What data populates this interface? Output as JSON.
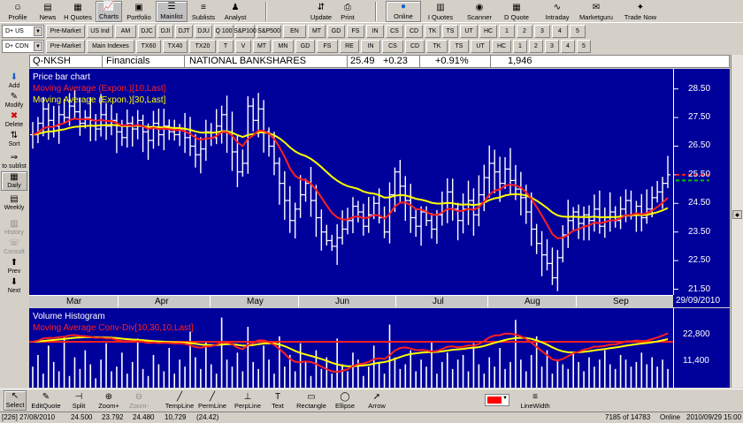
{
  "toolbar": {
    "items": [
      {
        "label": "Profile",
        "icon": "profile-icon",
        "glyph": "☺"
      },
      {
        "label": "News",
        "icon": "news-icon",
        "glyph": "▤"
      },
      {
        "label": "H Quotes",
        "icon": "history-quotes-icon",
        "glyph": "▦"
      },
      {
        "label": "Charts",
        "icon": "chart-icon",
        "glyph": "📈"
      },
      {
        "label": "Portfolio",
        "icon": "portfolio-icon",
        "glyph": "▣"
      },
      {
        "label": "Mainlist",
        "icon": "mainlist-icon",
        "glyph": "☰"
      },
      {
        "label": "Sublists",
        "icon": "sublists-icon",
        "glyph": "≡"
      },
      {
        "label": "Analyst",
        "icon": "analyst-icon",
        "glyph": "♟"
      },
      {
        "label": "Update",
        "icon": "update-icon",
        "glyph": "⇵"
      },
      {
        "label": "Print",
        "icon": "print-icon",
        "glyph": "⎙"
      },
      {
        "label": "Online",
        "icon": "online-globe-icon",
        "glyph": "●"
      },
      {
        "label": "I Quotes",
        "icon": "intraday-quotes-icon",
        "glyph": "▥"
      },
      {
        "label": "Scanner",
        "icon": "scanner-icon",
        "glyph": "◉"
      },
      {
        "label": "D Quote",
        "icon": "depth-quote-icon",
        "glyph": "▦"
      },
      {
        "label": "Intraday",
        "icon": "intraday-icon",
        "glyph": "∿"
      },
      {
        "label": "Marketguru",
        "icon": "marketguru-icon",
        "glyph": "✉"
      },
      {
        "label": "Trade Now",
        "icon": "trade-now-icon",
        "glyph": "✦"
      }
    ]
  },
  "row1": {
    "selector": "D+ US",
    "buttons": [
      "Pre-Market",
      "US Ind",
      "AM",
      "DJC",
      "DJI",
      "DJT",
      "DJU",
      "Q 100",
      "S&P100",
      "S&P500",
      "EN",
      "MT",
      "GD",
      "FS",
      "IN",
      "CS",
      "CD",
      "TK",
      "TS",
      "UT",
      "HC",
      "1",
      "2",
      "3",
      "4",
      "5"
    ]
  },
  "row2": {
    "selector": "D+ CDN",
    "buttons": [
      "Pre-Market",
      "Main Indexes",
      "TX60",
      "TX40",
      "TX20",
      "T",
      "V",
      "MT",
      "MN",
      "GD",
      "FS",
      "RE",
      "IN",
      "CS",
      "CD",
      "TK",
      "TS",
      "UT",
      "HC",
      "1",
      "2",
      "3",
      "4",
      "5"
    ]
  },
  "info": {
    "symbol": "Q-NKSH",
    "sector": "Financials",
    "name": "NATIONAL BANKSHARES",
    "price": "25.49",
    "change": "+0.23",
    "pct": "+0.91%",
    "volume": "1,946"
  },
  "sidebar": [
    {
      "label": "Add",
      "icon": "add-arrow-icon",
      "glyph": "⬇"
    },
    {
      "label": "Modify",
      "icon": "modify-pencil-icon",
      "glyph": "✎"
    },
    {
      "label": "Delete",
      "icon": "delete-x-icon",
      "glyph": "✖"
    },
    {
      "label": "Sort",
      "icon": "sort-icon",
      "glyph": "⇅"
    },
    {
      "label": "to sublist",
      "icon": "to-sublist-icon",
      "glyph": "⇒"
    },
    {
      "label": "Daily",
      "icon": "daily-icon",
      "glyph": "▦"
    },
    {
      "label": "Weekly",
      "icon": "weekly-icon",
      "glyph": "▤"
    },
    {
      "label": "History",
      "icon": "history-icon",
      "glyph": "▥"
    },
    {
      "label": "Consult",
      "icon": "consult-icon",
      "glyph": "☏"
    },
    {
      "label": "Prev",
      "icon": "prev-arrow-icon",
      "glyph": "⬆"
    },
    {
      "label": "Next",
      "icon": "next-arrow-icon",
      "glyph": "⬇"
    }
  ],
  "chart_data": [
    {
      "type": "bar",
      "title": "Price bar chart",
      "legend": [
        {
          "name": "Moving Average (Expon.)[10,Last]",
          "color": "#ff2020"
        },
        {
          "name": "Moving Average (Expon.)[30,Last]",
          "color": "#ffff00"
        }
      ],
      "x_labels": [
        "Mar",
        "Apr",
        "May",
        "Jun",
        "Jul",
        "Aug",
        "Sep"
      ],
      "y_ticks": [
        "28.50",
        "27.50",
        "26.50",
        "25.50",
        "24.50",
        "23.50",
        "22.50",
        "21.50"
      ],
      "ylim": [
        21.3,
        29.2
      ],
      "last_date": "29/09/2010",
      "closes": [
        26.9,
        27.3,
        27.8,
        27.4,
        27.2,
        27.6,
        27.5,
        27.9,
        27.7,
        27.3,
        27.5,
        27.4,
        27.1,
        27.6,
        27.2,
        27.4,
        27.0,
        26.8,
        27.3,
        27.1,
        27.4,
        27.0,
        26.7,
        27.3,
        26.9,
        27.2,
        27.0,
        26.9,
        27.1,
        26.8,
        26.5,
        26.2,
        26.4,
        27.0,
        26.8,
        27.2,
        27.6,
        27.0,
        26.3,
        25.6,
        25.9,
        27.9,
        27.4,
        27.8,
        27.0,
        26.5,
        25.9,
        25.2,
        24.6,
        23.9,
        24.3,
        24.8,
        25.2,
        24.6,
        24.0,
        23.5,
        23.2,
        23.0,
        23.3,
        23.6,
        23.9,
        24.4,
        24.2,
        23.7,
        24.1,
        24.5,
        24.0,
        23.5,
        24.8,
        25.6,
        25.1,
        24.6,
        24.0,
        23.7,
        24.2,
        23.9,
        23.6,
        24.1,
        24.5,
        24.9,
        24.3,
        23.9,
        24.3,
        24.6,
        24.1,
        24.8,
        25.4,
        25.9,
        25.6,
        25.2,
        25.7,
        25.3,
        25.0,
        24.7,
        24.2,
        23.6,
        23.1,
        22.7,
        22.4,
        21.9,
        22.6,
        23.4,
        23.9,
        24.2,
        23.8,
        24.1,
        23.9,
        24.3,
        23.7,
        24.0,
        24.2,
        23.9,
        24.3,
        24.6,
        24.1,
        24.4,
        24.0,
        24.3,
        24.7,
        24.9,
        25.2,
        25.5
      ],
      "ma10_color": "#ff2020",
      "ma30_color": "#ffff00",
      "marker_prices": [
        25.5,
        25.3
      ],
      "marker_colors": [
        "#ff2020",
        "#00c000"
      ]
    },
    {
      "type": "bar",
      "title": "Volume Histogram",
      "legend": [
        {
          "name": "Moving Average Conv-Div[10,30,10,Last]",
          "color": "#ff2020"
        }
      ],
      "y_ticks": [
        "22,800",
        "11,400"
      ],
      "ylim": [
        0,
        34000
      ],
      "volumes": [
        9000,
        14000,
        6000,
        18000,
        11000,
        7000,
        22000,
        5000,
        13000,
        8000,
        16000,
        10000,
        4000,
        12000,
        19000,
        7000,
        9000,
        15000,
        6000,
        11000,
        21000,
        8000,
        5000,
        14000,
        10000,
        7000,
        17000,
        6000,
        12000,
        9000,
        24000,
        13000,
        8000,
        20000,
        10000,
        6000,
        30000,
        12000,
        9000,
        15000,
        7000,
        26000,
        11000,
        8000,
        18000,
        12000,
        6000,
        22000,
        9000,
        14000,
        7000,
        19000,
        11000,
        5000,
        16000,
        8000,
        13000,
        6000,
        21000,
        10000,
        7000,
        15000,
        12000,
        5000,
        9000,
        18000,
        11000,
        6000,
        27000,
        13000,
        8000,
        10000,
        16000,
        7000,
        12000,
        9000,
        20000,
        6000,
        11000,
        15000,
        8000,
        12000,
        14000,
        7000,
        19000,
        10000,
        6000,
        13000,
        9000,
        17000,
        8000,
        11000,
        29000,
        12000,
        7000,
        14000,
        22000,
        9000,
        16000,
        6000,
        12000,
        10000,
        8000,
        15000,
        11000,
        7000,
        13000,
        9000,
        12000,
        16000,
        10000,
        8000,
        14000,
        12000,
        9000,
        11000,
        15000,
        10000,
        13000,
        9000,
        12000,
        8000
      ],
      "macd_color": "#ff2020",
      "signal_color": "#ffff00"
    }
  ],
  "drawbar": [
    {
      "label": "Select",
      "icon": "select-cursor-icon",
      "glyph": "↖"
    },
    {
      "label": "EditQuote",
      "icon": "edit-quote-icon",
      "glyph": "✎"
    },
    {
      "label": "Split",
      "icon": "split-icon",
      "glyph": "⊣"
    },
    {
      "label": "Zoom+",
      "icon": "zoom-in-icon",
      "glyph": "⊕"
    },
    {
      "label": "Zoom-",
      "icon": "zoom-out-icon",
      "glyph": "⊖"
    },
    {
      "label": "TempLine",
      "icon": "temp-line-icon",
      "glyph": "╱"
    },
    {
      "label": "PermLine",
      "icon": "perm-line-icon",
      "glyph": "╱"
    },
    {
      "label": "PerpLine",
      "icon": "perp-line-icon",
      "glyph": "⊥"
    },
    {
      "label": "Text",
      "icon": "text-tool-icon",
      "glyph": "T"
    },
    {
      "label": "Rectangle",
      "icon": "rectangle-icon",
      "glyph": "▭"
    },
    {
      "label": "Ellipse",
      "icon": "ellipse-icon",
      "glyph": "◯"
    },
    {
      "label": "Arrow",
      "icon": "arrow-tool-icon",
      "glyph": "➚"
    },
    {
      "label": "LineWidth",
      "icon": "line-width-icon",
      "glyph": "≡"
    }
  ],
  "line_color": "#ff0000",
  "status": {
    "record": "[226] 27/08/2010",
    "open": "24.500",
    "low": "23.792",
    "close": "24.480",
    "volume": "10,729",
    "extra": "(24.42)",
    "count": "7185 of 14783",
    "state": "Online",
    "date": "2010/09/29",
    "time": "15:00"
  }
}
